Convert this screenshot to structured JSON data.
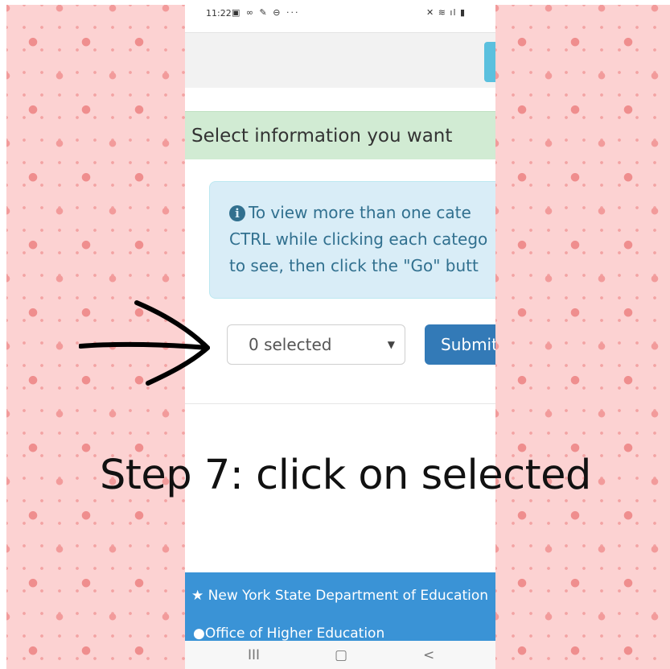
{
  "statusbar": {
    "time": "11:22",
    "left_icons": "▣ ∞ ✎ ⊖ ···",
    "right_icons": "✕ ≋ ıl ▮"
  },
  "section": {
    "title": "Select information you want"
  },
  "info": {
    "line1": "To view more than one cate",
    "line2": "CTRL while clicking each catego",
    "line3": "to see, then click the \"Go\" butt"
  },
  "form": {
    "select_value": "0 selected",
    "submit_label": "Submit"
  },
  "overlay": {
    "caption": "Step 7: click on selected"
  },
  "footer": {
    "link1": "New York State Department of Education",
    "link2": "Office of Higher Education"
  },
  "navbar": {
    "recents": "III",
    "home": "▢",
    "back": "<"
  },
  "colors": {
    "accent": "#337ab7",
    "success_bg": "#d1ebd3",
    "info_bg": "#d9edf7",
    "footer_bg": "#3a93d6",
    "pattern_bg": "#fcd2d2"
  }
}
